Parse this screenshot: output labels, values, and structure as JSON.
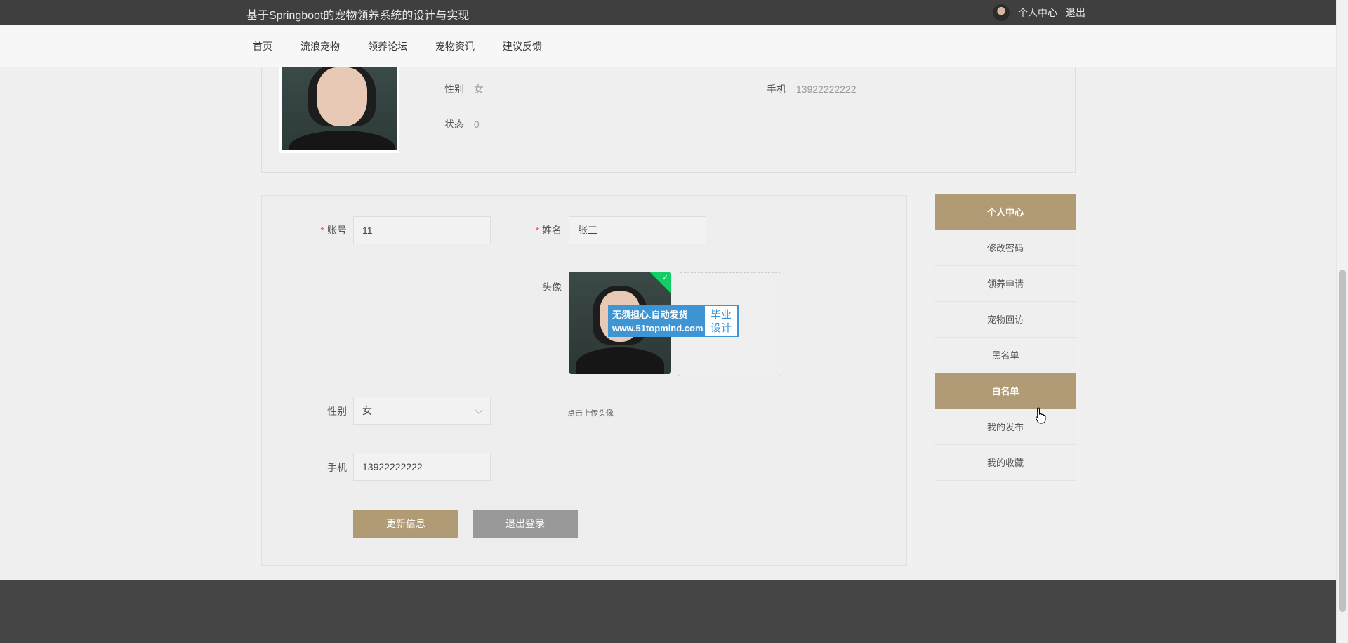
{
  "header": {
    "site_title": "基于Springboot的宠物领养系统的设计与实现",
    "user_center": "个人中心",
    "logout": "退出"
  },
  "nav": {
    "items": [
      "首页",
      "流浪宠物",
      "领养论坛",
      "宠物资讯",
      "建议反馈"
    ]
  },
  "profile": {
    "gender_label": "性别",
    "gender_value": "女",
    "phone_label": "手机",
    "phone_value": "13922222222",
    "status_label": "状态",
    "status_value": "0"
  },
  "form": {
    "account_label": "账号",
    "account_value": "11",
    "name_label": "姓名",
    "name_value": "张三",
    "avatar_label": "头像",
    "upload_hint": "点击上传头像",
    "gender_label": "性别",
    "gender_value": "女",
    "phone_label": "手机",
    "phone_value": "13922222222",
    "update_button": "更新信息",
    "logout_button": "退出登录"
  },
  "watermark": {
    "line1": "无须担心.自动发货",
    "line2": "www.51topmind.com",
    "right1": "毕业",
    "right2": "设计"
  },
  "side_menu": {
    "items": [
      "个人中心",
      "修改密码",
      "领养申请",
      "宠物回访",
      "黑名单",
      "白名单",
      "我的发布",
      "我的收藏"
    ],
    "active_items": [
      "个人中心",
      "白名单"
    ]
  },
  "colors": {
    "accent": "#b09b74",
    "topbar": "#3f3f3f",
    "footer": "#454545",
    "success": "#13ce66",
    "watermark_blue": "#3f95d4"
  }
}
